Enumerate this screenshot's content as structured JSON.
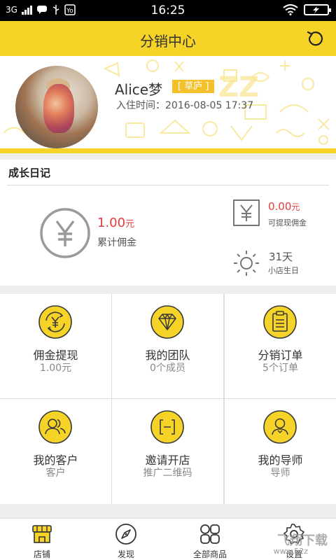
{
  "status_bar": {
    "network": "3G",
    "time": "16:25"
  },
  "header": {
    "title": "分销中心",
    "refresh_icon": "refresh-icon"
  },
  "profile": {
    "name": "Alice梦",
    "badge": "[ 草庐 ]",
    "join_time": "入住时间：2016-08-05 17:37"
  },
  "growth": {
    "title": "成长日记",
    "total_commission": {
      "amount": "1.00",
      "unit": "元",
      "label": "累计佣金"
    },
    "withdrawable": {
      "amount": "0.00",
      "unit": "元",
      "label": "可提现佣金"
    },
    "store_birthday": {
      "value": "31天",
      "label": "小店生日"
    }
  },
  "menu": [
    {
      "label": "佣金提现",
      "sub": "1.00元",
      "icon": "yen-exchange-icon"
    },
    {
      "label": "我的团队",
      "sub": "0个成员",
      "icon": "diamond-icon"
    },
    {
      "label": "分销订单",
      "sub": "5个订单",
      "icon": "clipboard-icon"
    },
    {
      "label": "我的客户",
      "sub": "客户",
      "icon": "users-icon"
    },
    {
      "label": "邀请开店",
      "sub": "推广二维码",
      "icon": "scan-icon"
    },
    {
      "label": "我的导师",
      "sub": "导师",
      "icon": "mentor-icon"
    }
  ],
  "tabs": [
    {
      "label": "店铺",
      "icon": "store-icon",
      "active": true
    },
    {
      "label": "发现",
      "icon": "compass-icon",
      "active": false
    },
    {
      "label": "全部商品",
      "icon": "grid-icon",
      "active": false
    },
    {
      "label": "设置",
      "icon": "settings-icon",
      "active": false
    }
  ],
  "watermark": {
    "main": "飞翔下载",
    "sub": "www.52z"
  },
  "colors": {
    "accent": "#f5d327",
    "money": "#e33b3b"
  }
}
